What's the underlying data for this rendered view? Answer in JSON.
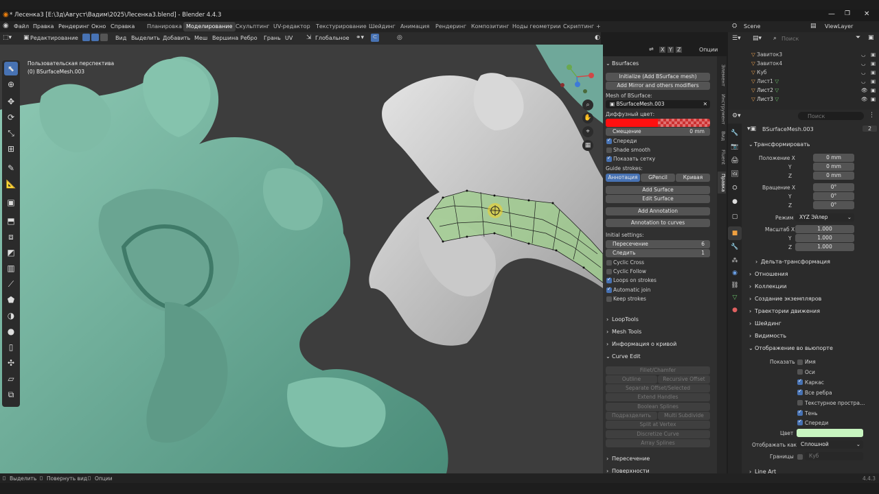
{
  "window": {
    "title": "* Лесенка3 [E:\\3д\\Август\\Вадим\\2025\\Лесенка3.blend] - Blender 4.4.3"
  },
  "menu": {
    "items": [
      "Файл",
      "Правка",
      "Рендеринг",
      "Окно",
      "Справка"
    ],
    "workspaces": [
      "Планировка",
      "Моделирование",
      "Скульптинг",
      "UV-редактор",
      "Текстурирование",
      "Шейдинг",
      "Анимация",
      "Рендеринг",
      "Композитинг",
      "Ноды геометрии",
      "Скриптинг"
    ],
    "active_workspace": "Моделирование",
    "add_tab": "+",
    "scene": "Scene",
    "view_layer": "ViewLayer"
  },
  "header3d": {
    "mode": "Редактирование",
    "items": [
      "Вид",
      "Выделить",
      "Добавить",
      "Меш",
      "Вершина",
      "Ребро",
      "Грань",
      "UV"
    ],
    "orientation": "Глобальное",
    "options": "Опции",
    "axes": [
      "X",
      "Y",
      "Z"
    ]
  },
  "viewport": {
    "view_name": "Пользовательская перспектива",
    "object_name": "(0) BSurfaceMesh.003",
    "gizmo": {
      "x": "X",
      "y": "Y",
      "z": "Z"
    }
  },
  "npanel": {
    "bsurfaces_title": "Bsurfaces",
    "init_btn": "Initialize (Add BSurface mesh)",
    "mirror_btn": "Add Mirror and others modifiers",
    "mesh_label": "Mesh of BSurface:",
    "mesh_value": "BSurfaceMesh.003",
    "diffuse_label": "Диффузный цвет:",
    "diffuse_color": "#ff1010",
    "offset_label": "Смещение",
    "offset_value": "0 mm",
    "front": "Спереди",
    "shade_smooth": "Shade smooth",
    "show_grid": "Показать сетку",
    "guide_label": "Guide strokes:",
    "guide_tabs": [
      "Аннотация",
      "GPencil",
      "Кривая"
    ],
    "add_surface": "Add Surface",
    "edit_surface": "Edit Surface",
    "add_annotation": "Add Annotation",
    "annotation_curves": "Annotation to curves",
    "initial": "Initial settings:",
    "cross_label": "Пересечение",
    "cross_value": "6",
    "follow_label": "Следить",
    "follow_value": "1",
    "cyclic_cross": "Cyclic Cross",
    "cyclic_follow": "Cyclic Follow",
    "loops": "Loops on strokes",
    "auto_join": "Automatic join",
    "keep": "Keep strokes",
    "looptools": "LoopTools",
    "meshtools": "Mesh Tools",
    "curve_info": "Информация о кривой",
    "curve_edit": "Curve Edit",
    "curve_buttons": {
      "fillet": "Fillet/Chamfer",
      "outline": "Outline",
      "recursive": "Recursive Offset",
      "separate": "Separate Offset/Selected",
      "extend": "Extend Handles",
      "boolean": "Boolean Splines",
      "subdivide": "Подразделить",
      "multi_sub": "Multi Subdivide",
      "split": "Split at Vertex",
      "discretize": "Discretize Curve",
      "array": "Array Splines"
    },
    "intersection": "Пересечение",
    "surfaces": "Поверхности",
    "vtabs": [
      "Элемент",
      "Инструмент",
      "Вид",
      "Fluent",
      "Правка"
    ]
  },
  "outliner": {
    "search": "Поиск",
    "items": [
      "Завиток3",
      "Завиток4",
      "Куб",
      "Лист1",
      "Лист2",
      "Лист3"
    ]
  },
  "props": {
    "search": "Поиск",
    "object": "BSurfaceMesh.003",
    "users": "2",
    "transform": "Трансформировать",
    "location_label": "Положение X",
    "loc": [
      "0 mm",
      "0 mm",
      "0 mm"
    ],
    "rotation_label": "Вращение X",
    "rot": [
      "0°",
      "0°",
      "0°"
    ],
    "mode_label": "Режим",
    "mode_value": "XYZ Эйлер",
    "scale_label": "Масштаб X",
    "scale": [
      "1.000",
      "1.000",
      "1.000"
    ],
    "axis_y": "Y",
    "axis_z": "Z",
    "delta": "Дельта-трансформация",
    "sections": [
      "Отношения",
      "Коллекции",
      "Создание экземпляров",
      "Траектории движения",
      "Шейдинг",
      "Видимость",
      "Отображение во вьюпорте"
    ],
    "show_label": "Показать",
    "show_items": [
      {
        "label": "Имя",
        "on": false
      },
      {
        "label": "Оси",
        "on": false
      },
      {
        "label": "Каркас",
        "on": true
      },
      {
        "label": "Все ребра",
        "on": true
      },
      {
        "label": "Текстурное простра…",
        "on": false
      },
      {
        "label": "Тень",
        "on": true
      },
      {
        "label": "Спереди",
        "on": true
      }
    ],
    "color_label": "Цвет",
    "color_value": "#c8f5c0",
    "display_label": "Отображать как",
    "display_value": "Сплошной",
    "bounds_label": "Границы",
    "bounds_value": "Куб",
    "lineart": "Line Art"
  },
  "status": {
    "select": "Выделить",
    "rotate": "Повернуть вид",
    "options": "Опции",
    "version": "4.4.3"
  }
}
